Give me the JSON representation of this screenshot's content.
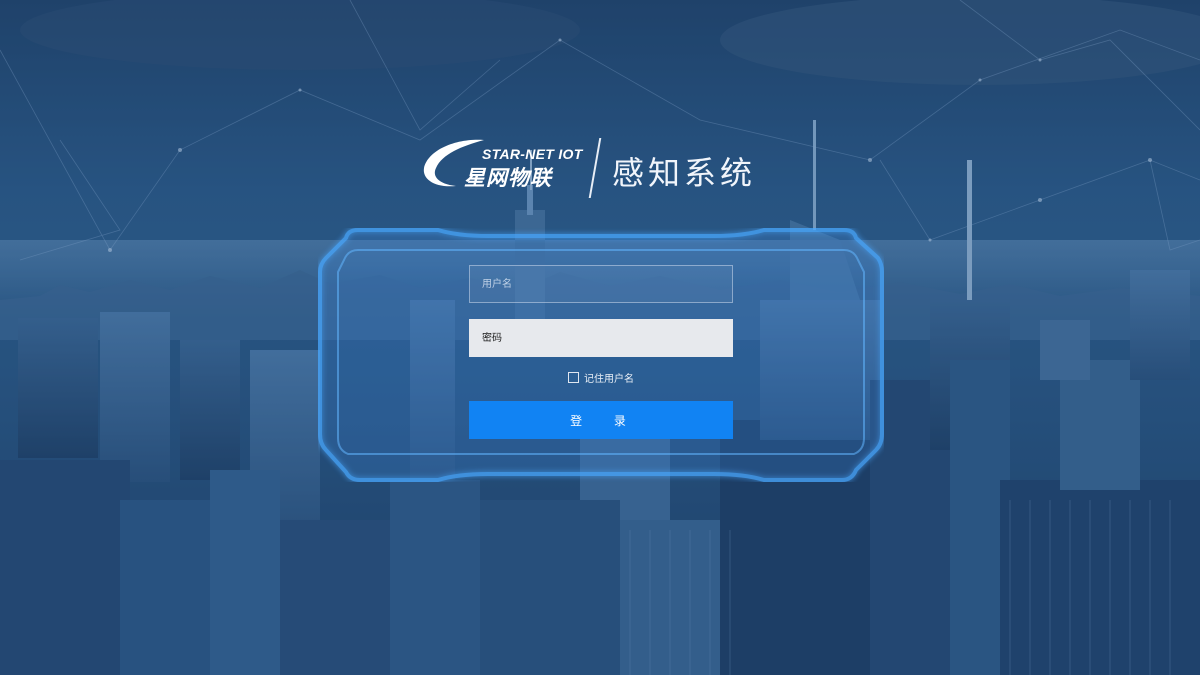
{
  "brand": {
    "logo_en": "STAR-NET IOT",
    "logo_cn": "星网物联",
    "system_title": "感知系统"
  },
  "login": {
    "username_placeholder": "用户名",
    "password_placeholder": "密码",
    "remember_label": "记住用户名",
    "remember_checked": false,
    "submit_label": "登 录"
  },
  "colors": {
    "background": "#2a5684",
    "button": "#1183f3",
    "frame_glow": "#3aa0ff"
  }
}
